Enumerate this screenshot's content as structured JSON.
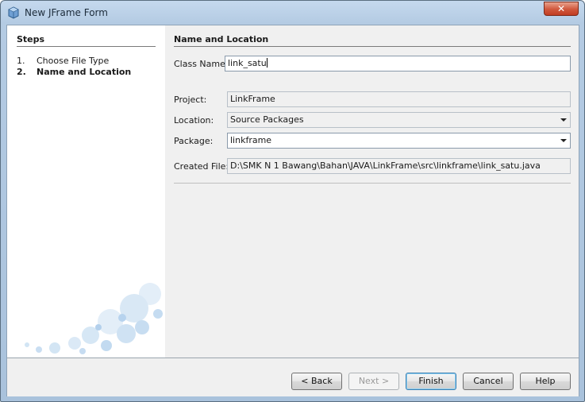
{
  "window": {
    "title": "New JFrame Form",
    "close_glyph": "✕"
  },
  "steps": {
    "title": "Steps",
    "items": [
      {
        "num": "1.",
        "label": "Choose File Type",
        "active": false
      },
      {
        "num": "2.",
        "label": "Name and Location",
        "active": true
      }
    ]
  },
  "form": {
    "section_title": "Name and Location",
    "class_name": {
      "label": "Class Name:",
      "value": "link_satu"
    },
    "project": {
      "label": "Project:",
      "value": "LinkFrame"
    },
    "location": {
      "label": "Location:",
      "value": "Source Packages"
    },
    "package": {
      "label": "Package:",
      "value": "linkframe"
    },
    "created_file": {
      "label": "Created File:",
      "value": "D:\\SMK N 1 Bawang\\Bahan\\JAVA\\LinkFrame\\src\\linkframe\\link_satu.java"
    }
  },
  "buttons": {
    "back": "< Back",
    "next": "Next >",
    "finish": "Finish",
    "cancel": "Cancel",
    "help": "Help"
  }
}
